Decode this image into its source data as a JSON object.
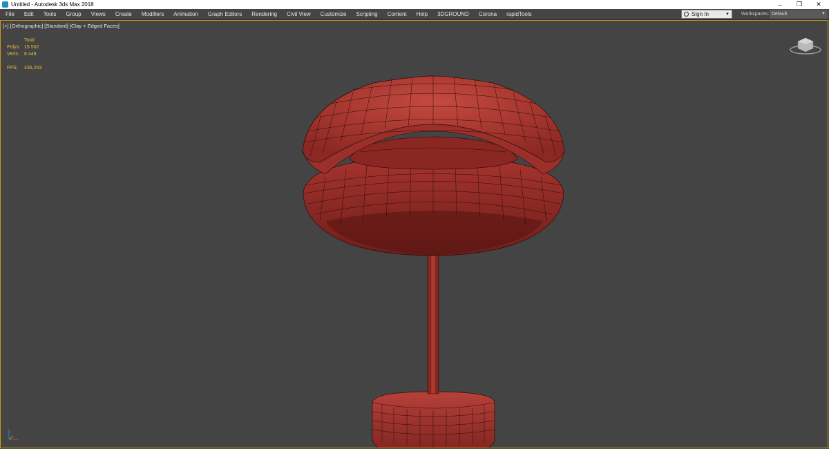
{
  "window": {
    "title": "Untitled - Autodesk 3ds Max 2018"
  },
  "window_controls": [
    "–",
    "❒",
    "✕"
  ],
  "menu": [
    "File",
    "Edit",
    "Tools",
    "Group",
    "Views",
    "Create",
    "Modifiers",
    "Animation",
    "Graph Editors",
    "Rendering",
    "Civil View",
    "Customize",
    "Scripting",
    "Content",
    "Help",
    "3DGROUND",
    "Corona",
    "rapidTools"
  ],
  "account": {
    "sign_in": "Sign In"
  },
  "workspaces": {
    "label": "Workspaces:",
    "value": "Default"
  },
  "viewport": {
    "label": "[+] [Orthographic] [Standard] [Clay + Edged Faces]",
    "stats": {
      "header": "Total",
      "polys_label": "Polys:",
      "polys": "15 562",
      "verts_label": "Verts:",
      "verts": "8 449",
      "fps_label": "FPS:",
      "fps": "436,243"
    }
  },
  "colors": {
    "viewport_bg": "#444444",
    "active_border": "#c79a1b",
    "clay_red": "#b13a33",
    "stats_text": "#e3c233"
  }
}
